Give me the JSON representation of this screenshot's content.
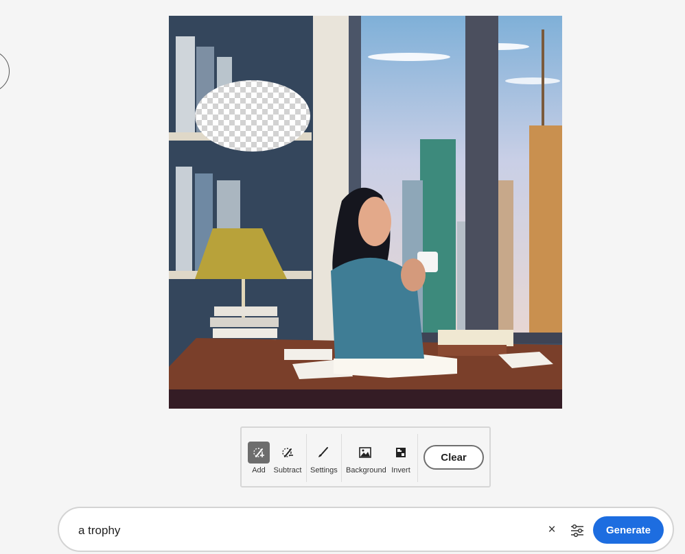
{
  "tools": [
    {
      "label": "Add",
      "icon": "brush-add-icon",
      "active": true
    },
    {
      "label": "Subtract",
      "icon": "brush-subtract-icon",
      "active": false
    },
    {
      "label": "Settings",
      "icon": "brush-icon",
      "active": false
    },
    {
      "label": "Background",
      "icon": "image-icon",
      "active": false
    },
    {
      "label": "Invert",
      "icon": "invert-icon",
      "active": false
    }
  ],
  "toolbar": {
    "clear_label": "Clear"
  },
  "prompt": {
    "value": "a trophy",
    "clear_symbol": "×",
    "generate_label": "Generate"
  },
  "colors": {
    "accent": "#1d6de0",
    "active_tool": "#6d6d6d"
  }
}
